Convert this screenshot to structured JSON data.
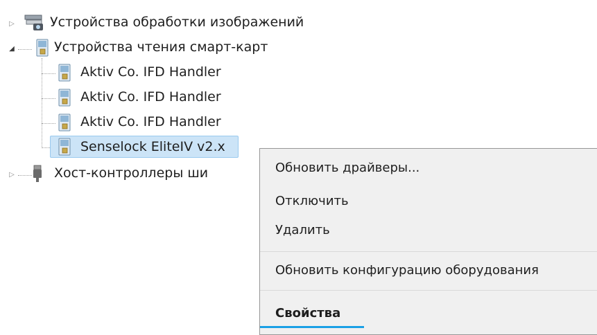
{
  "tree": {
    "items": [
      {
        "label": "Устройства обработки изображений",
        "expanded": false,
        "icon": "imaging-device-icon"
      },
      {
        "label": "Устройства чтения смарт-карт",
        "expanded": true,
        "icon": "smart-card-reader-icon"
      },
      {
        "label": "Aktiv Co. IFD Handler",
        "icon": "smart-card-reader-icon"
      },
      {
        "label": "Aktiv Co. IFD Handler",
        "icon": "smart-card-reader-icon"
      },
      {
        "label": "Aktiv Co. IFD Handler",
        "icon": "smart-card-reader-icon"
      },
      {
        "label": "Senselock EliteIV v2.x",
        "icon": "smart-card-reader-icon",
        "selected": true
      },
      {
        "label": "Хост-контроллеры ши",
        "expanded": false,
        "icon": "usb-controller-icon"
      }
    ]
  },
  "context_menu": {
    "items": [
      {
        "label": "Обновить драйверы..."
      },
      {
        "label": "Отключить"
      },
      {
        "label": "Удалить"
      },
      {
        "label": "Обновить конфигурацию оборудования"
      },
      {
        "label": "Свойства",
        "bold": true
      }
    ],
    "accent_color": "#1aa0e6"
  },
  "colors": {
    "selection_fill": "#cce4f7",
    "selection_border": "#99c9ef",
    "menu_bg": "#f0f0f0"
  }
}
